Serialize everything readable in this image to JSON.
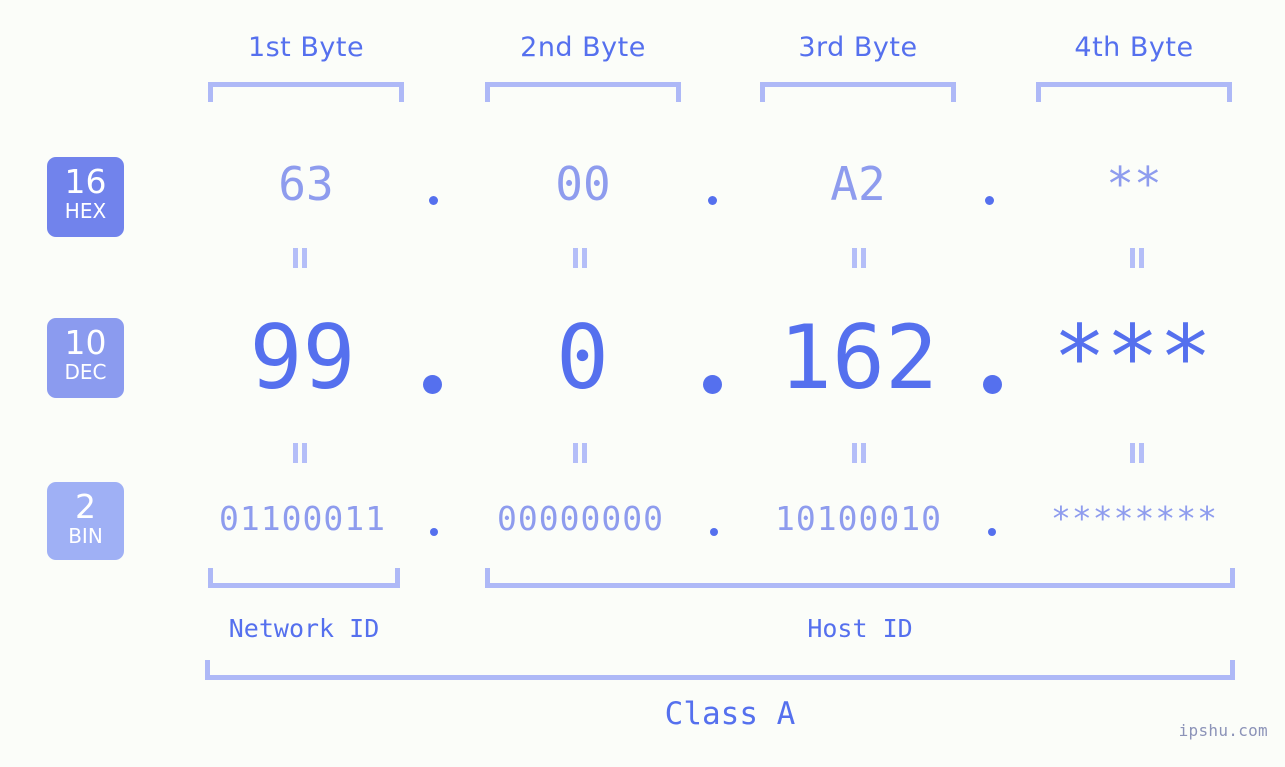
{
  "background_color": "#fbfdf9",
  "colors": {
    "accent_strong": "#5570ee",
    "accent_light": "#8e9cee",
    "bracket": "#aeb9f7",
    "badge_hex": "#7183ec",
    "badge_dec": "#8b9bef",
    "badge_bin": "#9fb0f5",
    "watermark": "#8c93b8"
  },
  "byte_headers": [
    {
      "label": "1st Byte"
    },
    {
      "label": "2nd Byte"
    },
    {
      "label": "3rd Byte"
    },
    {
      "label": "4th Byte"
    }
  ],
  "rows": [
    {
      "badge_num": "16",
      "badge_abbr": "HEX",
      "values": [
        "63",
        "00",
        "A2",
        "**"
      ],
      "separator": "."
    },
    {
      "badge_num": "10",
      "badge_abbr": "DEC",
      "values": [
        "99",
        "0",
        "162",
        "***"
      ],
      "separator": "."
    },
    {
      "badge_num": "2",
      "badge_abbr": "BIN",
      "values": [
        "01100011",
        "00000000",
        "10100010",
        "********"
      ],
      "separator": "."
    }
  ],
  "equality_marks": {
    "glyph": "=",
    "count_per_gap": 4,
    "gaps": 2
  },
  "segments": [
    {
      "label": "Network ID"
    },
    {
      "label": "Host ID"
    }
  ],
  "class": {
    "label": "Class A"
  },
  "watermark": {
    "text": "ipshu.com"
  }
}
